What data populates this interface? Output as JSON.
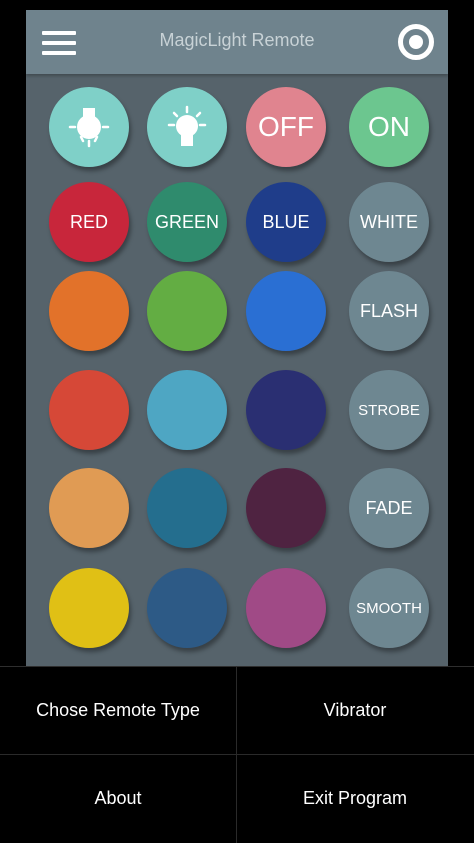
{
  "app": {
    "title": "MagicLight Remote",
    "menu_icon": "hamburger-menu-icon",
    "power_icon": "power-toggle-icon"
  },
  "buttons": [
    {
      "id": "brightness-down",
      "label": "",
      "icon": "bulb-dim-icon",
      "color": "#7fd0c8"
    },
    {
      "id": "brightness-up",
      "label": "",
      "icon": "bulb-bright-icon",
      "color": "#7fd0c8"
    },
    {
      "id": "off",
      "label": "OFF",
      "color": "#e0848f"
    },
    {
      "id": "on",
      "label": "ON",
      "color": "#6cc68f"
    },
    {
      "id": "red",
      "label": "RED",
      "color": "#c8263b"
    },
    {
      "id": "green",
      "label": "GREEN",
      "color": "#2f8b6d"
    },
    {
      "id": "blue",
      "label": "BLUE",
      "color": "#1f3d8a"
    },
    {
      "id": "white",
      "label": "WHITE",
      "color": "#6e8791"
    },
    {
      "id": "orange",
      "label": "",
      "color": "#e2722a"
    },
    {
      "id": "light-green",
      "label": "",
      "color": "#63ad43"
    },
    {
      "id": "medium-blue",
      "label": "",
      "color": "#2a6fd3"
    },
    {
      "id": "flash",
      "label": "FLASH",
      "color": "#6e8791"
    },
    {
      "id": "red-orange",
      "label": "",
      "color": "#d64837"
    },
    {
      "id": "sky-blue",
      "label": "",
      "color": "#4ea6c3"
    },
    {
      "id": "indigo",
      "label": "",
      "color": "#2a2f72"
    },
    {
      "id": "strobe",
      "label": "STROBE",
      "color": "#6e8791"
    },
    {
      "id": "light-orange",
      "label": "",
      "color": "#e09b54"
    },
    {
      "id": "teal-blue",
      "label": "",
      "color": "#246e8e"
    },
    {
      "id": "plum",
      "label": "",
      "color": "#4f2341"
    },
    {
      "id": "fade",
      "label": "FADE",
      "color": "#6e8791"
    },
    {
      "id": "yellow",
      "label": "",
      "color": "#e0c015"
    },
    {
      "id": "steel-blue",
      "label": "",
      "color": "#2d5a86"
    },
    {
      "id": "magenta",
      "label": "",
      "color": "#a04a86"
    },
    {
      "id": "smooth",
      "label": "SMOOTH",
      "color": "#6e8791"
    }
  ],
  "menu": {
    "remote_type": "Chose Remote Type",
    "vibrator": "Vibrator",
    "about": "About",
    "exit": "Exit Program"
  }
}
